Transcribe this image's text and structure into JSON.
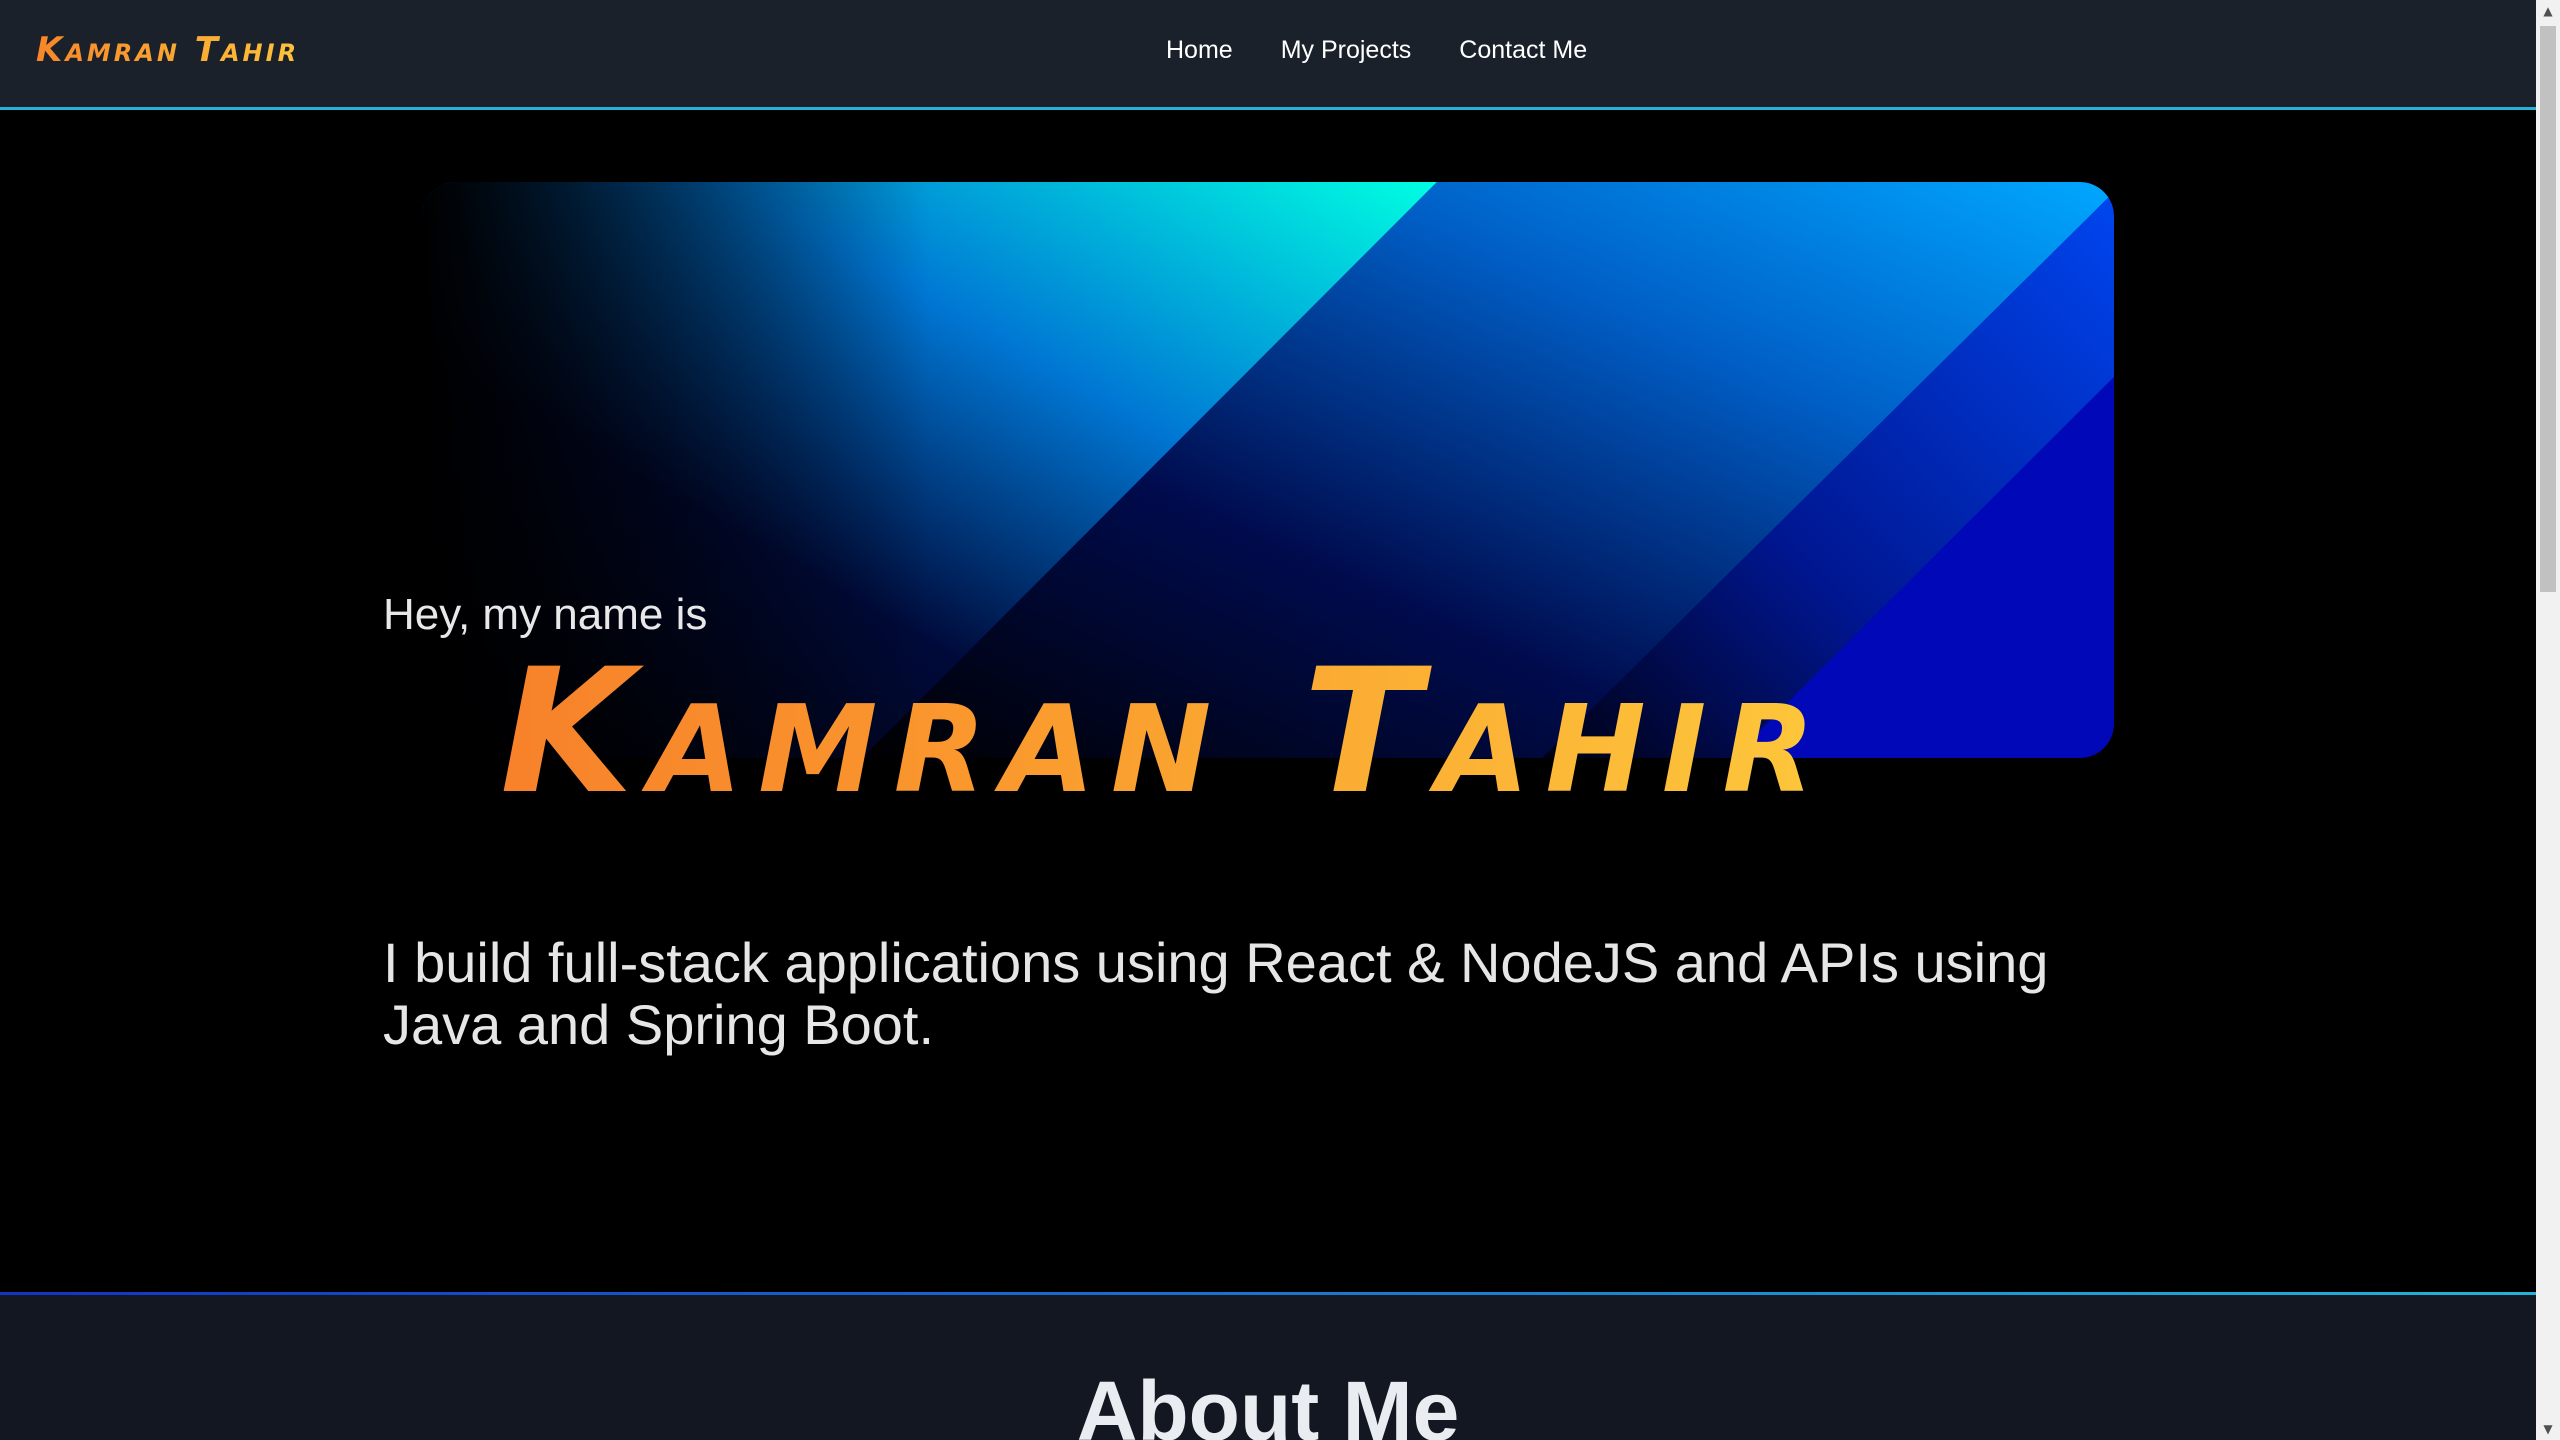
{
  "navbar": {
    "brand": "Kamran Tahir",
    "links": [
      {
        "label": "Home"
      },
      {
        "label": "My Projects"
      },
      {
        "label": "Contact Me"
      }
    ]
  },
  "hero": {
    "greeting": "Hey, my name is",
    "name": "Kamran Tahir",
    "tagline": "I build full-stack applications using React & NodeJS and APIs using Java and Spring Boot."
  },
  "about": {
    "title": "About Me"
  },
  "colors": {
    "navbar_bg": "#1b212b",
    "accent_line": "#22b3d6",
    "name_gradient_start": "#f7812a",
    "name_gradient_end": "#fdc73b",
    "hero_bg": "#000000",
    "about_bg": "#131722"
  }
}
